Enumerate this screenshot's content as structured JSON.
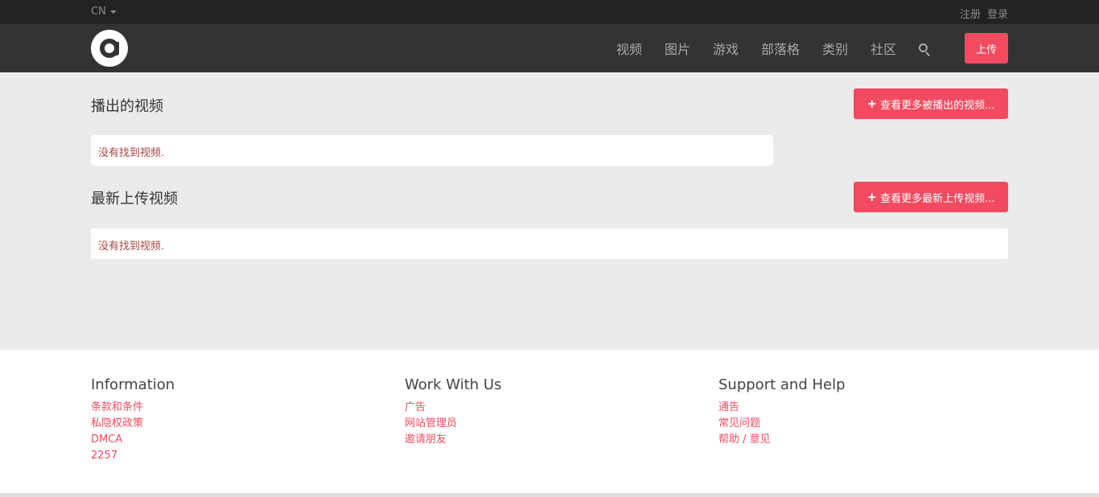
{
  "topbar": {
    "language": "CN",
    "register": "注册",
    "login": "登录"
  },
  "nav": {
    "items": [
      "视频",
      "图片",
      "游戏",
      "部落格",
      "类别",
      "社区"
    ],
    "upload": "上传"
  },
  "sections": [
    {
      "title": "播出的视频",
      "more": "查看更多被播出的视频...",
      "empty": "没有找到视频."
    },
    {
      "title": "最新上传视频",
      "more": "查看更多最新上传视频...",
      "empty": "没有找到视频."
    }
  ],
  "footer": {
    "columns": [
      {
        "heading": "Information",
        "links": [
          "条款和条件",
          "私隐权政策",
          "DMCA",
          "2257"
        ]
      },
      {
        "heading": "Work With Us",
        "links": [
          "广告",
          "网站管理员",
          "邀请朋友"
        ]
      },
      {
        "heading": "Support and Help",
        "links": [
          "通告",
          "常见问题",
          "帮助 / 意见"
        ]
      }
    ]
  },
  "colors": {
    "accent": "#f24a61",
    "topbar": "#222222",
    "navbar": "#333333",
    "background": "#ebebeb",
    "empty_text": "#a94442"
  }
}
